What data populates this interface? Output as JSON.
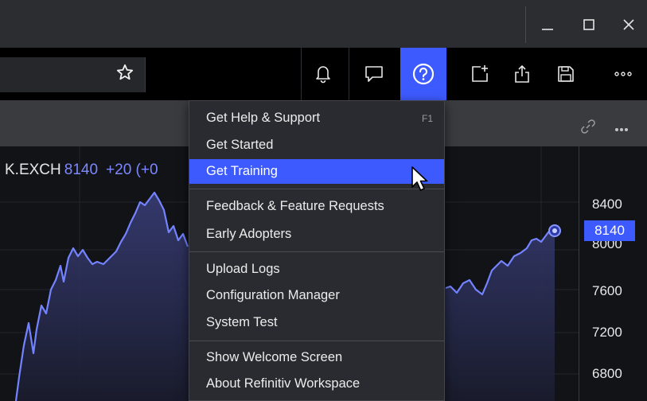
{
  "window": {
    "minimize_icon": "minimize-icon",
    "maximize_icon": "maximize-icon",
    "close_icon": "close-icon"
  },
  "toolbar": {
    "search_value": "",
    "icons": [
      "star-icon",
      "bell-icon",
      "chat-icon",
      "help-icon",
      "new-window-icon",
      "share-icon",
      "save-icon",
      "more-icon"
    ]
  },
  "panel": {
    "icons": [
      "link-icon",
      "more-icon"
    ]
  },
  "chart": {
    "symbol": "K.EXCH",
    "price": "8140",
    "change": "+20 (+0",
    "current_price_label": "8140",
    "accent_color": "#3d5afe"
  },
  "chart_data": {
    "type": "area",
    "y_ticks": [
      "8400",
      "8000",
      "7600",
      "7200",
      "6800"
    ],
    "last_value": 8140
  },
  "help_menu": {
    "items": [
      {
        "label": "Get Help & Support",
        "shortcut": "F1"
      },
      {
        "label": "Get Started"
      },
      {
        "label": "Get Training"
      },
      {
        "label": "Feedback & Feature Requests"
      },
      {
        "label": "Early Adopters"
      },
      {
        "label": "Upload Logs"
      },
      {
        "label": "Configuration Manager"
      },
      {
        "label": "System Test"
      },
      {
        "label": "Show Welcome Screen"
      },
      {
        "label": "About Refinitiv Workspace"
      }
    ],
    "highlighted": "Get Training"
  }
}
